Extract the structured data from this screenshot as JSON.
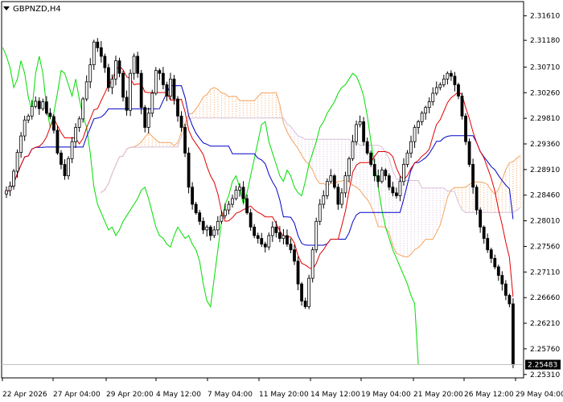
{
  "chart_data": {
    "type": "candlestick",
    "symbol": "GBPNZD,H4",
    "current_price": "2.25483",
    "y_ticks": [
      "2.31610",
      "2.31180",
      "2.30710",
      "2.30260",
      "2.29810",
      "2.29360",
      "2.28910",
      "2.28460",
      "2.28010",
      "2.27560",
      "2.27110",
      "2.26660",
      "2.26210",
      "2.25760",
      "2.25310"
    ],
    "ylim": [
      2.2525,
      2.3186
    ],
    "x_ticks": [
      "22 Apr 2026",
      "27 Apr 04:00",
      "29 Apr 20:00",
      "4 May 12:00",
      "7 May 04:00",
      "11 May 20:00",
      "14 May 12:00",
      "19 May 04:00",
      "21 May 20:00",
      "26 May 12:00",
      "29 May 04:00"
    ],
    "grid": false,
    "indicator": "Ichimoku Kinko Hyo",
    "colors": {
      "background": "#ffffff",
      "candle": "#000000",
      "tenkan": "#e00000",
      "kijun": "#0000c8",
      "chikou": "#00dd00",
      "cloud_bull": "#f4a460",
      "cloud_bear": "#d8bfd8"
    },
    "close": [
      2.2854,
      2.2862,
      2.2888,
      2.2921,
      2.295,
      2.2978,
      2.2985,
      2.3002,
      2.3011,
      2.2998,
      2.301,
      2.299,
      2.2984,
      2.296,
      2.292,
      2.29,
      2.288,
      2.291,
      2.294,
      2.2965,
      2.298,
      2.3015,
      2.3045,
      2.3075,
      2.3115,
      2.3105,
      2.309,
      2.307,
      2.3035,
      2.305,
      2.3082,
      2.306,
      2.3018,
      2.2995,
      2.306,
      2.309,
      2.306,
      2.3,
      2.2965,
      2.299,
      2.3025,
      2.3065,
      2.306,
      2.304,
      2.302,
      2.305,
      2.3015,
      2.2985,
      2.2965,
      2.292,
      2.286,
      2.283,
      2.2815,
      2.28,
      2.2785,
      2.279,
      2.2775,
      2.2785,
      2.28,
      2.281,
      2.282,
      2.283,
      2.284,
      2.2855,
      2.286,
      2.284,
      2.2815,
      2.279,
      2.2775,
      2.277,
      2.276,
      2.2755,
      2.2775,
      2.279,
      2.278,
      2.277,
      2.2775,
      2.276,
      2.275,
      2.273,
      2.269,
      2.266,
      2.265,
      2.27,
      2.275,
      2.28,
      2.283,
      2.2845,
      2.287,
      2.288,
      2.286,
      2.283,
      2.285,
      2.288,
      2.291,
      2.294,
      2.297,
      2.2975,
      2.294,
      2.292,
      2.29,
      2.288,
      2.287,
      2.289,
      2.288,
      2.286,
      2.285,
      2.2845,
      2.287,
      2.29,
      2.292,
      2.294,
      2.2965,
      2.2975,
      2.299,
      2.3,
      2.301,
      2.3025,
      2.3035,
      2.304,
      2.305,
      2.306,
      2.3055,
      2.304,
      2.302,
      2.2985,
      2.294,
      2.29,
      2.286,
      2.282,
      2.279,
      2.277,
      2.275,
      2.2735,
      2.272,
      2.2705,
      2.269,
      2.267,
      2.2655,
      2.2548
    ]
  }
}
